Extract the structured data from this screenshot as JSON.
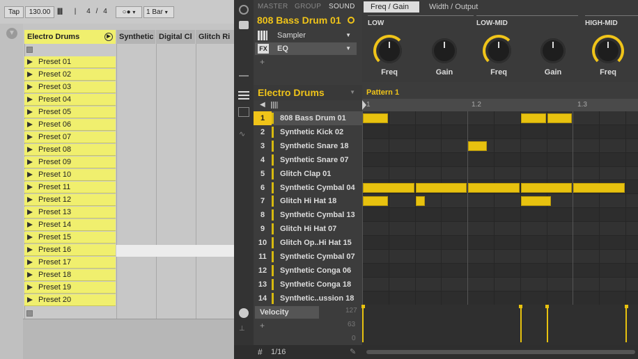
{
  "ableton": {
    "transport": {
      "tap": "Tap",
      "tempo": "130.00",
      "meter_num": "4",
      "meter_sep": "/",
      "meter_den": "4",
      "quant": "1 Bar"
    },
    "tracks": [
      {
        "name": "Electro Drums",
        "accent": "#f0ef6e"
      },
      {
        "name": "Synthetic"
      },
      {
        "name": "Digital Cl"
      },
      {
        "name": "Glitch Ri"
      }
    ],
    "presets": [
      "Preset 01",
      "Preset 02",
      "Preset 03",
      "Preset 04",
      "Preset 05",
      "Preset 06",
      "Preset 07",
      "Preset 08",
      "Preset 09",
      "Preset 10",
      "Preset 11",
      "Preset 12",
      "Preset 13",
      "Preset 14",
      "Preset 15",
      "Preset 16",
      "Preset 17",
      "Preset 18",
      "Preset 19",
      "Preset 20"
    ]
  },
  "maschine": {
    "header_tabs": [
      "MASTER",
      "GROUP",
      "SOUND"
    ],
    "sound_name": "808 Bass Drum 01",
    "plugins": [
      {
        "slot": "",
        "name": "Sampler"
      },
      {
        "slot": "FX",
        "name": "EQ"
      }
    ],
    "add_label": "+",
    "param_tabs": [
      "Freq / Gain",
      "Width / Output"
    ],
    "sections": [
      "LOW",
      "LOW-MID",
      "HIGH-MID"
    ],
    "knobs": [
      {
        "label": "Freq",
        "level": 0.55
      },
      {
        "label": "Gain",
        "level": 0.5
      },
      {
        "label": "Freq",
        "level": 0.6
      },
      {
        "label": "Gain",
        "level": 0.5
      },
      {
        "label": "Freq",
        "level": 0.7
      }
    ],
    "group_name": "Electro Drums",
    "pattern_name": "Pattern 1",
    "ruler_labels": [
      "1",
      "1.2",
      "1.3"
    ],
    "pads": [
      {
        "num": "1",
        "name": "808 Bass Drum 01"
      },
      {
        "num": "2",
        "name": "Synthetic Kick 02"
      },
      {
        "num": "3",
        "name": "Synthetic Snare 18"
      },
      {
        "num": "4",
        "name": "Synthetic Snare 07"
      },
      {
        "num": "5",
        "name": "Glitch Clap 01"
      },
      {
        "num": "6",
        "name": "Synthetic Cymbal 04"
      },
      {
        "num": "7",
        "name": "Glitch Hi Hat 18"
      },
      {
        "num": "8",
        "name": "Synthetic Cymbal 13"
      },
      {
        "num": "9",
        "name": "Glitch Hi Hat 07"
      },
      {
        "num": "10",
        "name": "Glitch Op..Hi Hat 15"
      },
      {
        "num": "11",
        "name": "Synthetic Cymbal 07"
      },
      {
        "num": "12",
        "name": "Synthetic Conga 06"
      },
      {
        "num": "13",
        "name": "Synthetic Conga 18"
      },
      {
        "num": "14",
        "name": "Synthetic..ussion 18"
      }
    ],
    "notes": [
      {
        "row": 0,
        "step": 0,
        "len": 1
      },
      {
        "row": 0,
        "step": 6,
        "len": 1
      },
      {
        "row": 0,
        "step": 7,
        "len": 1
      },
      {
        "row": 2,
        "step": 4,
        "len": 0.75
      },
      {
        "row": 5,
        "step": 0,
        "len": 2
      },
      {
        "row": 5,
        "step": 2,
        "len": 2
      },
      {
        "row": 5,
        "step": 4,
        "len": 2
      },
      {
        "row": 5,
        "step": 6,
        "len": 2
      },
      {
        "row": 5,
        "step": 8,
        "len": 2
      },
      {
        "row": 6,
        "step": 0,
        "len": 1
      },
      {
        "row": 6,
        "step": 2,
        "len": 0.4
      },
      {
        "row": 6,
        "step": 6,
        "len": 1.2
      }
    ],
    "velocity_label": "Velocity",
    "velocity_ticks": [
      "127",
      "63",
      "0"
    ],
    "velocity_hits": [
      {
        "step": 0,
        "value": 1
      },
      {
        "step": 6,
        "value": 1
      },
      {
        "step": 7,
        "value": 1
      },
      {
        "step": 10,
        "value": 1
      }
    ],
    "grid_label": "1/16",
    "colors": {
      "accent": "#f0c419",
      "note": "#e8c20f"
    }
  }
}
